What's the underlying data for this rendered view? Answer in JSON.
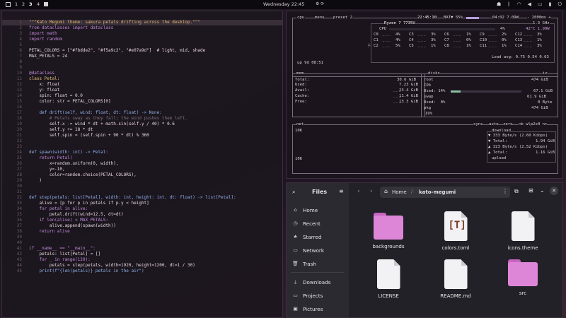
{
  "topbar": {
    "workspaces": [
      "1",
      "2",
      "3",
      "4"
    ],
    "clock": "Wednesday 22:45"
  },
  "editor": {
    "lines": [
      {
        "n": "1",
        "t": "\"\"\"Kato Megumi theme: sakura petals drifting across the desktop.\"\"\"",
        "k": "str"
      },
      {
        "n": "2",
        "t": "from dataclasses import dataclass",
        "k": "kw"
      },
      {
        "n": "3",
        "t": "import math",
        "k": "kw"
      },
      {
        "n": "4",
        "t": "import random",
        "k": "kw"
      },
      {
        "n": "5",
        "t": "",
        "k": ""
      },
      {
        "n": "6",
        "t": "PETAL_COLORS = [\"#fbdde2\", \"#f5a9c2\", \"#e07a9d\"]  # light, mid, shade",
        "k": "var"
      },
      {
        "n": "7",
        "t": "MAX_PETALS = 24",
        "k": "var"
      },
      {
        "n": "8",
        "t": "",
        "k": ""
      },
      {
        "n": "9",
        "t": "",
        "k": ""
      },
      {
        "n": "10",
        "t": "@dataclass",
        "k": "dec"
      },
      {
        "n": "11",
        "t": "class Petal:",
        "k": "cls"
      },
      {
        "n": "12",
        "t": "    x: float",
        "k": "var"
      },
      {
        "n": "13",
        "t": "    y: float",
        "k": "var"
      },
      {
        "n": "14",
        "t": "    spin: float = 0.0",
        "k": "var"
      },
      {
        "n": "15",
        "t": "    color: str = PETAL_COLORS[0]",
        "k": "var"
      },
      {
        "n": "16",
        "t": "",
        "k": ""
      },
      {
        "n": "17",
        "t": "    def drift(self, wind: float, dt: float) -> None:",
        "k": "fn"
      },
      {
        "n": "18",
        "t": "        # Petals sway as they fall; the wind pushes them left.",
        "k": "com"
      },
      {
        "n": "19",
        "t": "        self.x -= wind * dt + math.sin(self.y / 40) * 0.6",
        "k": "var"
      },
      {
        "n": "20",
        "t": "        self.y += 18 * dt",
        "k": "var"
      },
      {
        "n": "21",
        "t": "        self.spin = (self.spin + 90 * dt) % 360",
        "k": "var"
      },
      {
        "n": "22",
        "t": "",
        "k": ""
      },
      {
        "n": "23",
        "t": "",
        "k": ""
      },
      {
        "n": "24",
        "t": "def spawn(width: int) -> Petal:",
        "k": "fn"
      },
      {
        "n": "25",
        "t": "    return Petal(",
        "k": "kw"
      },
      {
        "n": "26",
        "t": "        x=random.uniform(0, width),",
        "k": "var"
      },
      {
        "n": "27",
        "t": "        y=-10,",
        "k": "var"
      },
      {
        "n": "28",
        "t": "        color=random.choice(PETAL_COLORS),",
        "k": "var"
      },
      {
        "n": "29",
        "t": "    )",
        "k": "var"
      },
      {
        "n": "30",
        "t": "",
        "k": ""
      },
      {
        "n": "31",
        "t": "",
        "k": ""
      },
      {
        "n": "32",
        "t": "def step(petals: list[Petal], width: int, height: int, dt: float) -> list[Petal]:",
        "k": "fn"
      },
      {
        "n": "33",
        "t": "    alive = [p for p in petals if p.y < height]",
        "k": "var"
      },
      {
        "n": "34",
        "t": "    for petal in alive:",
        "k": "kw"
      },
      {
        "n": "35",
        "t": "        petal.drift(wind=12.5, dt=dt)",
        "k": "var"
      },
      {
        "n": "36",
        "t": "    if len(alive) < MAX_PETALS:",
        "k": "kw"
      },
      {
        "n": "37",
        "t": "        alive.append(spawn(width))",
        "k": "var"
      },
      {
        "n": "38",
        "t": "    return alive",
        "k": "kw"
      },
      {
        "n": "39",
        "t": "",
        "k": ""
      },
      {
        "n": "40",
        "t": "",
        "k": ""
      },
      {
        "n": "41",
        "t": "if __name__ == \"__main__\":",
        "k": "kw"
      },
      {
        "n": "42",
        "t": "    petals: list[Petal] = []",
        "k": "var"
      },
      {
        "n": "43",
        "t": "    for _ in range(120):",
        "k": "kw"
      },
      {
        "n": "44",
        "t": "        petals = step(petals, width=1920, height=1200, dt=1 / 30)",
        "k": "var"
      },
      {
        "n": "45",
        "t": "    print(f\"{len(petals)} petals in the air\")",
        "k": "fn"
      }
    ]
  },
  "btop": {
    "cpu_header": {
      "title": "cpu",
      "menu": "menu",
      "preset": "preset 2",
      "time": "22:45:10",
      "battery": "BAT▼ 55%",
      "battery_level": 55,
      "bat_time": "04:02 7.09W",
      "interval": "- 2000ms +"
    },
    "cpu_model": "Ryzen 7 7735U",
    "cpu_freq": "1.3 GHz",
    "cpu_total_label": "CPU",
    "cpu_total_pct": "4%",
    "cpu_temp": "42°C 1.90W",
    "cores": [
      {
        "l": "C0",
        "p": "4%",
        "t": "53°"
      },
      {
        "l": "C3",
        "p": "3%",
        "t": "53°"
      },
      {
        "l": "C6",
        "p": "1%",
        "t": "53°"
      },
      {
        "l": "C9",
        "p": "2%",
        "t": "53°"
      },
      {
        "l": "C12",
        "p": "3%",
        "t": "53°"
      },
      {
        "l": "C1",
        "p": "4%",
        "t": "53°"
      },
      {
        "l": "C4",
        "p": "3%",
        "t": "53°"
      },
      {
        "l": "C7",
        "p": "0%",
        "t": "53°"
      },
      {
        "l": "C10",
        "p": "0%",
        "t": "53°"
      },
      {
        "l": "C13",
        "p": "1%",
        "t": "53°"
      },
      {
        "l": "C2",
        "p": "5%",
        "t": "53°"
      },
      {
        "l": "C5",
        "p": "1%",
        "t": "53°"
      },
      {
        "l": "C8",
        "p": "1%",
        "t": "53°"
      },
      {
        "l": "C11",
        "p": "1%",
        "t": "53°"
      },
      {
        "l": "C14",
        "p": "3%",
        "t": "53°"
      }
    ],
    "load_avg": "Load avg: 0.75 0.54 0.63",
    "uptime": "up 9d 08:51",
    "mem": {
      "title": "mem",
      "total": "Total:",
      "total_v": "30.6 GiB",
      "used": "Used:",
      "used_v": "7.23 GiB",
      "avail": "Avail:",
      "avail_v": "23.4 GiB",
      "cache": "Cache:",
      "cache_v": "11.4 GiB",
      "free": "Free:",
      "free_v": "13.3 GiB"
    },
    "disks": {
      "title": "disks",
      "io": "io",
      "root": "root",
      "root_size": "474 GiB",
      "io_pct": "IO%",
      "used_label": "Used: 14%",
      "used_v": "67.1 GiB",
      "free_label": "Free: 86%",
      "free_v": "407 GiB",
      "swap": "swap",
      "swap_size": "61.9 GiB",
      "swap_used": "Used:  0%",
      "swap_used_v": "0 Byte",
      "pkg": "pkg",
      "pkg_size": "474 GiB",
      "pkg_io": "IO%"
    },
    "net": {
      "title": "net",
      "sync": "sync",
      "auto": "auto",
      "zero": "zero",
      "iface": "<b wlp2s0 n>",
      "scale_top": "10K",
      "scale_bot": "10K",
      "download": "download",
      "dl_rate": "333 Byte/s (2.60 Kibps)",
      "dl_top": "323 Byte/s (2.52 Kibps)",
      "dl_total": "Total:",
      "dl_total_v": "1.94 GiB",
      "ul_total": "Total:",
      "ul_total_v": "1.16 GiB",
      "upload": "upload"
    }
  },
  "files": {
    "app_title": "Files",
    "path": {
      "home": "Home",
      "current": "kato-megumi"
    },
    "sidebar": [
      {
        "icon": "home-icon",
        "glyph": "⌂",
        "label": "Home"
      },
      {
        "icon": "clock-icon",
        "glyph": "◷",
        "label": "Recent"
      },
      {
        "icon": "star-icon",
        "glyph": "★",
        "label": "Starred"
      },
      {
        "icon": "network-icon",
        "glyph": "▭",
        "label": "Network"
      },
      {
        "icon": "trash-icon",
        "glyph": "🗑",
        "label": "Trash"
      },
      {
        "icon": "download-icon",
        "glyph": "⤓",
        "label": "Downloads"
      },
      {
        "icon": "folder-icon",
        "glyph": "▭",
        "label": "Projects"
      },
      {
        "icon": "image-icon",
        "glyph": "▣",
        "label": "Pictures"
      }
    ],
    "items": [
      {
        "name": "backgrounds",
        "type": "folder"
      },
      {
        "name": "colors.toml",
        "type": "toml"
      },
      {
        "name": "icons.theme",
        "type": "doc"
      },
      {
        "name": "LICENSE",
        "type": "doc"
      },
      {
        "name": "README.md",
        "type": "doc"
      },
      {
        "name": "src",
        "type": "folder"
      }
    ]
  }
}
